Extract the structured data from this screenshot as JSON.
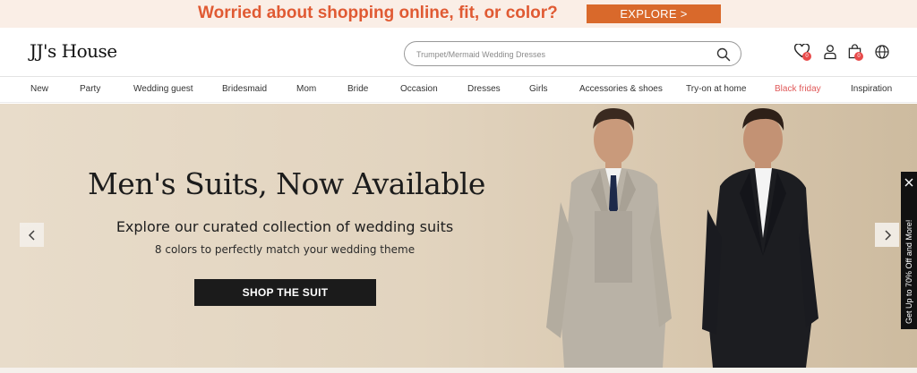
{
  "promo": {
    "text": "Worried about shopping online, fit, or color?",
    "button": "EXPLORE >"
  },
  "header": {
    "logo": "JJ's House",
    "search_placeholder": "Trumpet/Mermaid Wedding Dresses",
    "wishlist_count": "0",
    "cart_count": "0"
  },
  "nav": [
    "New",
    "Party",
    "Wedding guest",
    "Bridesmaid",
    "Mom",
    "Bride",
    "Occasion",
    "Dresses",
    "Girls",
    "Accessories & shoes",
    "Try-on at home",
    "Black friday",
    "Inspiration"
  ],
  "hero": {
    "title": "Men's Suits, Now Available",
    "subtitle": "Explore our curated collection of wedding suits",
    "tagline": "8 colors to perfectly match your wedding theme",
    "cta": "SHOP THE SUIT"
  },
  "side_tab": {
    "text": "Get Up to 70% Off and More!"
  },
  "colors": {
    "promo_bg": "#faeee6",
    "promo_text": "#e05a33",
    "promo_button": "#d9692b",
    "sale_link": "#e05a5a",
    "cta_bg": "#1b1b1b",
    "badge": "#e84a4a"
  },
  "icons": [
    "search-icon",
    "heart-icon",
    "user-icon",
    "bag-icon",
    "globe-icon",
    "chevron-left-icon",
    "chevron-right-icon",
    "close-icon"
  ]
}
